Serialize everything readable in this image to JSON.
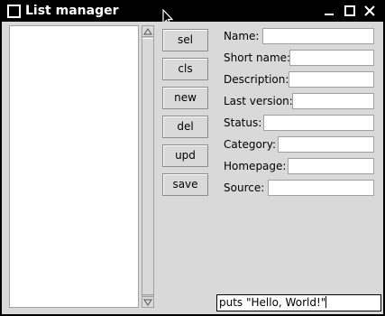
{
  "window": {
    "title": "List manager",
    "icons": {
      "app": "app-square-icon",
      "cursor": "mouse-pointer-icon",
      "minimize": "minimize-icon",
      "maximize": "maximize-icon",
      "close": "close-icon"
    }
  },
  "buttons": {
    "sel": "sel",
    "cls": "cls",
    "new": "new",
    "del": "del",
    "upd": "upd",
    "save": "save"
  },
  "form": {
    "name_label": "Name:",
    "short_name_label": "Short name:",
    "description_label": "Description:",
    "last_version_label": "Last version:",
    "status_label": "Status:",
    "category_label": "Category:",
    "homepage_label": "Homepage:",
    "source_label": "Source:"
  },
  "console": {
    "value": "puts \"Hello, World!\""
  },
  "colors": {
    "titlebar": "#000000",
    "client_bg": "#d9d9d9",
    "field_bg": "#ffffff"
  }
}
